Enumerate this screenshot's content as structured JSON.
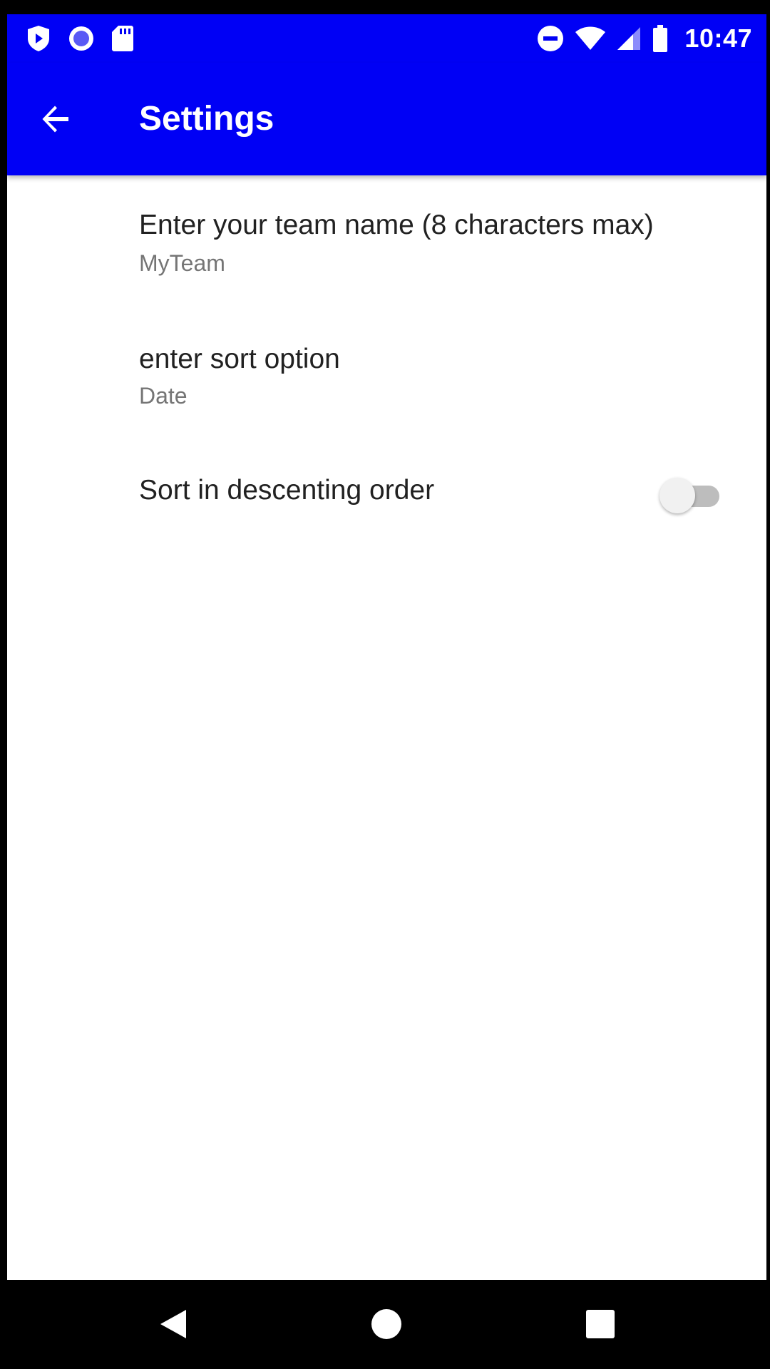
{
  "status_bar": {
    "time": "10:47",
    "left_icons": [
      "play-protect-icon",
      "record-icon",
      "sd-card-icon"
    ],
    "right_icons": [
      "do-not-disturb-icon",
      "wifi-icon",
      "cell-signal-icon",
      "battery-icon"
    ]
  },
  "toolbar": {
    "title": "Settings",
    "back_icon": "arrow-back-icon"
  },
  "preferences": [
    {
      "title": "Enter your team name (8 characters max)",
      "summary": "MyTeam"
    },
    {
      "title": "enter sort option",
      "summary": "Date"
    },
    {
      "title": "Sort in descenting order",
      "switch_checked": false
    }
  ],
  "nav_bar": {
    "icons": [
      "back-triangle-icon",
      "home-circle-icon",
      "recents-square-icon"
    ]
  },
  "colors": {
    "primary": "#0000f5",
    "background": "#ffffff",
    "title_text": "#212121",
    "summary_text": "#757575"
  }
}
